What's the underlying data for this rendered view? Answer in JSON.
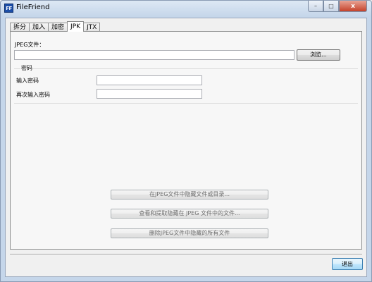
{
  "window": {
    "title": "FileFriend",
    "icon_text": "FF"
  },
  "window_controls": {
    "minimize": "–",
    "maximize": "□",
    "close": "x"
  },
  "tabs": [
    {
      "label": "拆分",
      "active": false
    },
    {
      "label": "加入",
      "active": false
    },
    {
      "label": "加密",
      "active": false
    },
    {
      "label": "JPK",
      "active": true
    },
    {
      "label": "JTX",
      "active": false
    }
  ],
  "jpk": {
    "jpeg_file_label": "JPEG文件：",
    "jpeg_file_value": "",
    "browse_label": "浏览...",
    "password_group_label": "密码",
    "password_label": "输入密码",
    "password_value": "",
    "confirm_password_label": "再次输入密码",
    "confirm_password_value": "",
    "hide_button_label": "在JPEG文件中隐藏文件或目录...",
    "extract_button_label": "查看和提取隐藏在 JPEG 文件中的文件...",
    "delete_button_label": "删除JPEG文件中隐藏的所有文件"
  },
  "footer": {
    "exit_label": "退出"
  },
  "colors": {
    "title_bar": "#c5d6ea",
    "close_button": "#c5422a",
    "focused_button_border": "#3c7fb1"
  }
}
